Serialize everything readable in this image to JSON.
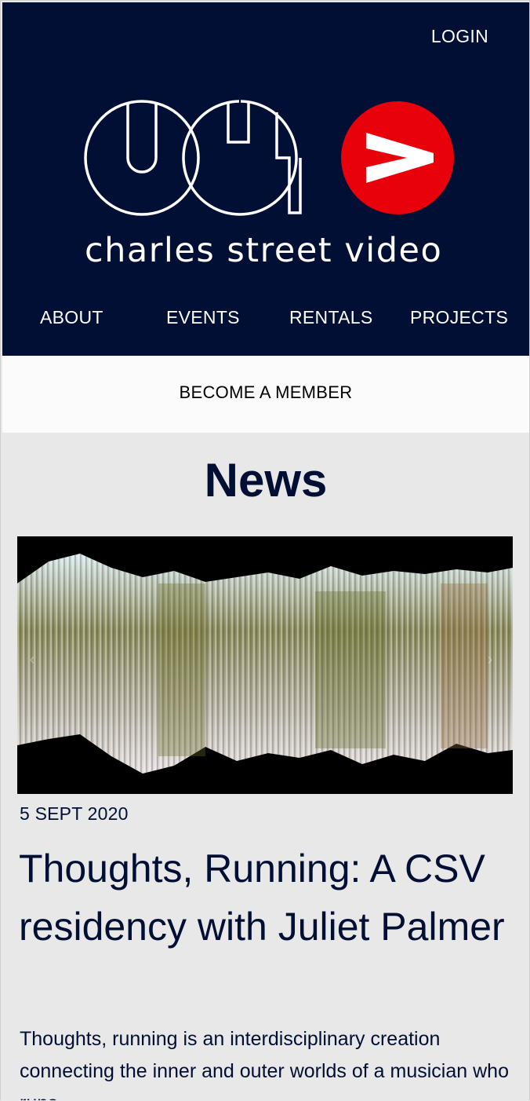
{
  "header": {
    "login_label": "LOGIN",
    "brand_name": "charles street video",
    "background_color": "#000f33",
    "accent_color": "#e8000b"
  },
  "nav": {
    "items": [
      {
        "label": "ABOUT"
      },
      {
        "label": "EVENTS"
      },
      {
        "label": "RENTALS"
      },
      {
        "label": "PROJECTS"
      }
    ]
  },
  "member_bar": {
    "label": "BECOME A MEMBER"
  },
  "news": {
    "heading": "News",
    "article": {
      "date": "5 SEPT 2020",
      "title": "Thoughts, Running: A CSV residency with Juliet Palmer",
      "excerpt": "Thoughts, running is an interdisciplinary creation connecting the inner and outer worlds of a musician who runs."
    },
    "carousel": {
      "prev_icon": "chevron-left-icon",
      "next_icon": "chevron-right-icon"
    }
  }
}
